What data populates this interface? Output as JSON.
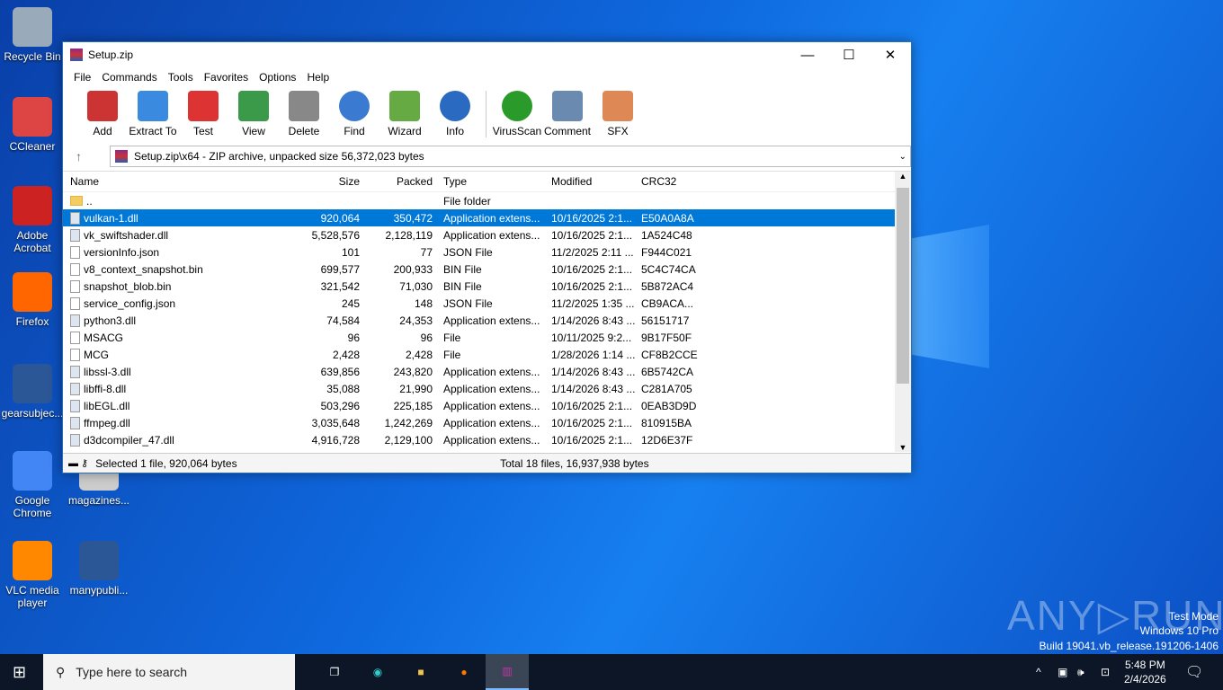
{
  "desktop": {
    "icons": [
      "Recycle Bin",
      "CCleaner",
      "Adobe Acrobat",
      "Firefox",
      "gearsubjec...",
      "Google Chrome",
      "magazines...",
      "VLC media player",
      "manypubli..."
    ]
  },
  "window": {
    "title": "Setup.zip",
    "menu": [
      "File",
      "Commands",
      "Tools",
      "Favorites",
      "Options",
      "Help"
    ],
    "toolbar": [
      "Add",
      "Extract To",
      "Test",
      "View",
      "Delete",
      "Find",
      "Wizard",
      "Info",
      "VirusScan",
      "Comment",
      "SFX"
    ],
    "address": "Setup.zip\\x64 - ZIP archive, unpacked size 56,372,023 bytes",
    "columns": [
      "Name",
      "Size",
      "Packed",
      "Type",
      "Modified",
      "CRC32"
    ],
    "rows": [
      [
        "..",
        "",
        "",
        "File folder",
        "",
        ""
      ],
      [
        "vulkan-1.dll",
        "920,064",
        "350,472",
        "Application extens...",
        "10/16/2025 2:1...",
        "E50A0A8A"
      ],
      [
        "vk_swiftshader.dll",
        "5,528,576",
        "2,128,119",
        "Application extens...",
        "10/16/2025 2:1...",
        "1A524C48"
      ],
      [
        "versionInfo.json",
        "101",
        "77",
        "JSON File",
        "11/2/2025 2:11 ...",
        "F944C021"
      ],
      [
        "v8_context_snapshot.bin",
        "699,577",
        "200,933",
        "BIN File",
        "10/16/2025 2:1...",
        "5C4C74CA"
      ],
      [
        "snapshot_blob.bin",
        "321,542",
        "71,030",
        "BIN File",
        "10/16/2025 2:1...",
        "5B872AC4"
      ],
      [
        "service_config.json",
        "245",
        "148",
        "JSON File",
        "11/2/2025 1:35 ...",
        "CB9ACA..."
      ],
      [
        "python3.dll",
        "74,584",
        "24,353",
        "Application extens...",
        "1/14/2026 8:43 ...",
        "56151717"
      ],
      [
        "MSACG",
        "96",
        "96",
        "File",
        "10/11/2025 9:2...",
        "9B17F50F"
      ],
      [
        "MCG",
        "2,428",
        "2,428",
        "File",
        "1/28/2026 1:14 ...",
        "CF8B2CCE"
      ],
      [
        "libssl-3.dll",
        "639,856",
        "243,820",
        "Application extens...",
        "1/14/2026 8:43 ...",
        "6B5742CA"
      ],
      [
        "libffi-8.dll",
        "35,088",
        "21,990",
        "Application extens...",
        "1/14/2026 8:43 ...",
        "C281A705"
      ],
      [
        "libEGL.dll",
        "503,296",
        "225,185",
        "Application extens...",
        "10/16/2025 2:1...",
        "0EAB3D9D"
      ],
      [
        "ffmpeg.dll",
        "3,035,648",
        "1,242,269",
        "Application extens...",
        "10/16/2025 2:1...",
        "810915BA"
      ],
      [
        "d3dcompiler_47.dll",
        "4,916,728",
        "2,129,100",
        "Application extens...",
        "10/16/2025 2:1...",
        "12D6E37F"
      ]
    ],
    "selected_index": 1,
    "status_left": "Selected 1 file, 920,064 bytes",
    "status_right": "Total 18 files, 16,937,938 bytes"
  },
  "taskbar": {
    "search_placeholder": "Type here to search",
    "time": "5:48 PM",
    "date": "2/4/2026"
  },
  "watermark": {
    "logo": "ANY RUN",
    "line1": "Test Mode",
    "line2": "Windows 10 Pro",
    "line3": "Build 19041.vb_release.191206-1406"
  }
}
